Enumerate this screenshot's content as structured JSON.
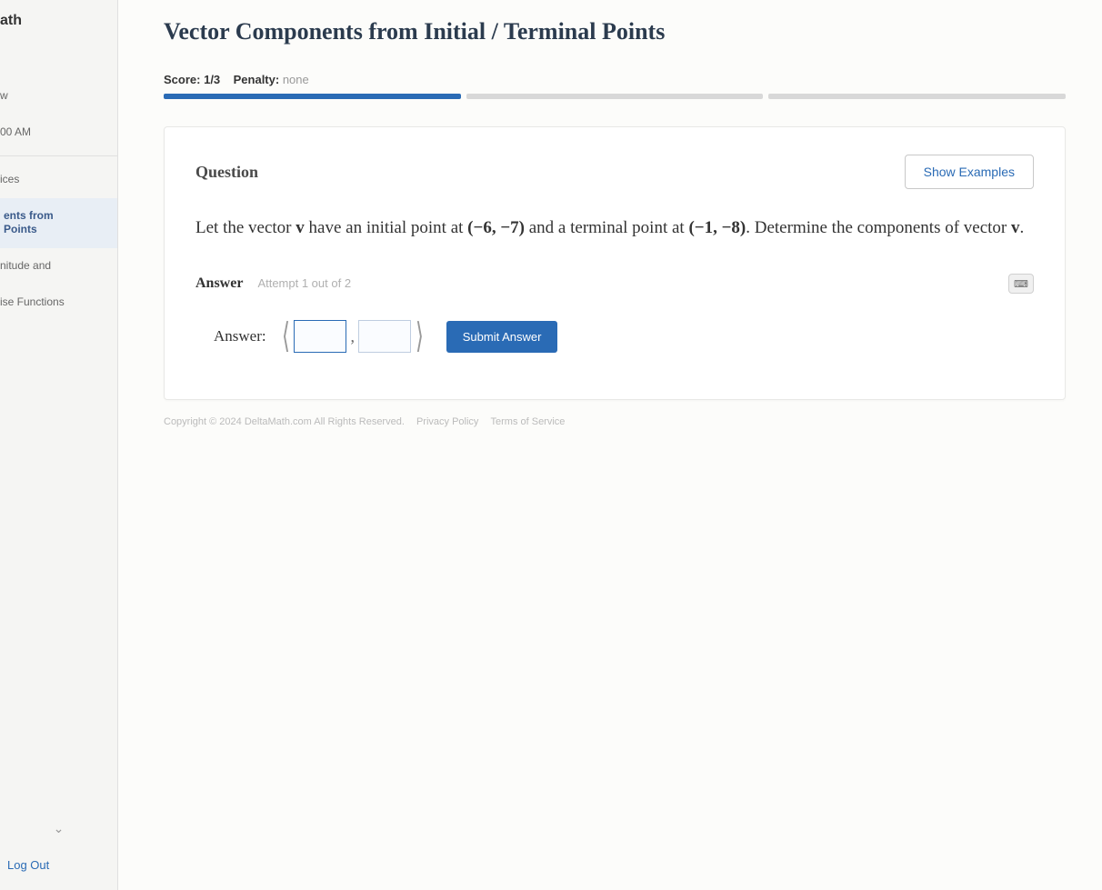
{
  "sidebar": {
    "brand": "ath",
    "items": [
      {
        "label": "w"
      },
      {
        "label": "00 AM"
      },
      {
        "label": "ices"
      },
      {
        "label": "ents from\nPoints"
      },
      {
        "label": "nitude and"
      },
      {
        "label": "ise Functions"
      }
    ],
    "logout": "Log Out"
  },
  "page": {
    "title": "Vector Components from Initial / Terminal Points",
    "score_label": "Score:",
    "score_value": "1/3",
    "penalty_label": "Penalty:",
    "penalty_value": "none",
    "progress_segments": 3,
    "progress_filled": 1
  },
  "question": {
    "heading": "Question",
    "show_examples": "Show Examples",
    "text_pre": "Let the vector ",
    "vec1": "v",
    "text_mid1": " have an initial point at ",
    "pt1": "(−6, −7)",
    "text_mid2": " and a terminal point at ",
    "pt2": "(−1, −8)",
    "text_mid3": ". Determine the components of vector ",
    "vec2": "v",
    "text_end": "."
  },
  "answer": {
    "label": "Answer",
    "attempt": "Attempt 1 out of 2",
    "label2": "Answer:",
    "submit": "Submit Answer",
    "input1": "",
    "input2": ""
  },
  "footer": {
    "copyright": "Copyright © 2024 DeltaMath.com All Rights Reserved.",
    "privacy": "Privacy Policy",
    "terms": "Terms of Service"
  }
}
